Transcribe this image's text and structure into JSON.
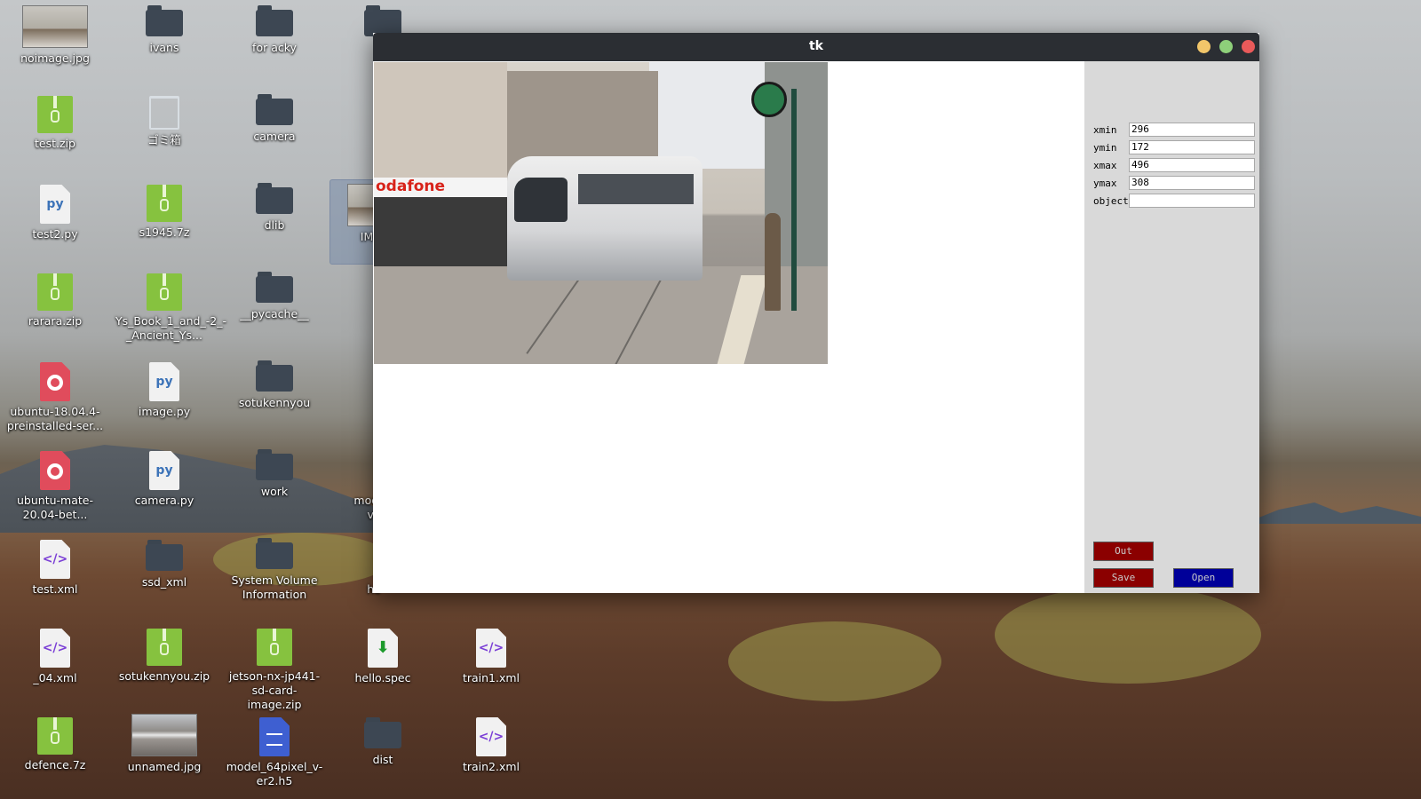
{
  "desktop": {
    "icons": [
      {
        "label": "noimage.jpg",
        "type": "image"
      },
      {
        "label": "ivans",
        "type": "folder"
      },
      {
        "label": "for acky",
        "type": "folder"
      },
      {
        "label": "test.zip",
        "type": "zip"
      },
      {
        "label": "ゴミ箱",
        "type": "trash"
      },
      {
        "label": "camera",
        "type": "folder"
      },
      {
        "label": "test2.py",
        "type": "python"
      },
      {
        "label": "s1945.7z",
        "type": "zip"
      },
      {
        "label": "dlib",
        "type": "folder"
      },
      {
        "label": "IMG_",
        "type": "image"
      },
      {
        "label": "rarara.zip",
        "type": "zip"
      },
      {
        "label": "Ys_Book_1_and_-2_-_Ancient_Ys...",
        "type": "zip"
      },
      {
        "label": "__pycache__",
        "type": "folder"
      },
      {
        "label": "ubuntu-18.04.4-preinstalled-ser...",
        "type": "disc"
      },
      {
        "label": "image.py",
        "type": "python"
      },
      {
        "label": "sotukennyou",
        "type": "folder"
      },
      {
        "label": "ubuntu-mate-20.04-bet...",
        "type": "disc"
      },
      {
        "label": "camera.py",
        "type": "python"
      },
      {
        "label": "work",
        "type": "folder"
      },
      {
        "label": "model_",
        "type": "h5"
      },
      {
        "label": "ve",
        "type": "h5"
      },
      {
        "label": "test.xml",
        "type": "xml"
      },
      {
        "label": "ssd_xml",
        "type": "folder"
      },
      {
        "label": "System Volume Information",
        "type": "folder"
      },
      {
        "label": "he",
        "type": "file"
      },
      {
        "label": "_04.xml",
        "type": "xml"
      },
      {
        "label": "sotukennyou.zip",
        "type": "zip"
      },
      {
        "label": "jetson-nx-jp441-sd-card-image.zip",
        "type": "zip"
      },
      {
        "label": "hello.spec",
        "type": "spec"
      },
      {
        "label": "train1.xml",
        "type": "xml"
      },
      {
        "label": "defence.7z",
        "type": "zip"
      },
      {
        "label": "unnamed.jpg",
        "type": "image"
      },
      {
        "label": "model_64pixel_v-er2.h5",
        "type": "h5"
      },
      {
        "label": "dist",
        "type": "folder"
      },
      {
        "label": "train2.xml",
        "type": "xml"
      }
    ]
  },
  "window": {
    "title": "tk",
    "photo": {
      "shop_sign": "odafone"
    },
    "panel": {
      "fields": [
        {
          "label": "xmin",
          "value": "296"
        },
        {
          "label": "ymin",
          "value": "172"
        },
        {
          "label": "xmax",
          "value": "496"
        },
        {
          "label": "ymax",
          "value": "308"
        },
        {
          "label": "object",
          "value": ""
        }
      ],
      "buttons": {
        "out": "Out",
        "save": "Save",
        "open": "Open"
      }
    }
  },
  "colors": {
    "titlebar": "#2b2e33",
    "panel_bg": "#d9d9d9",
    "btn_red": "#8b0000",
    "btn_blue": "#000099",
    "close": "#e95a5a",
    "minimize": "#f2c66a",
    "maximize": "#8ed07a"
  }
}
